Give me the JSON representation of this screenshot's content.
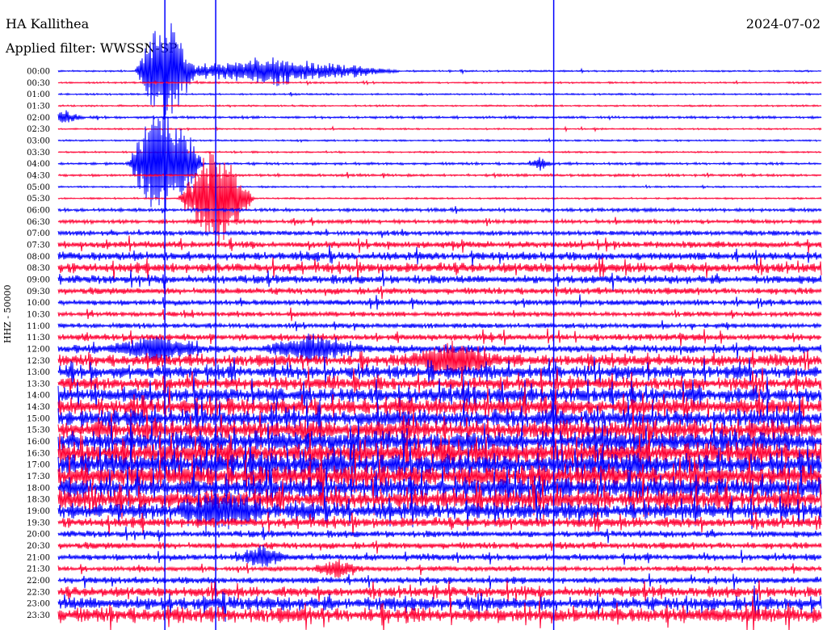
{
  "header": {
    "station": "HA Kallithea",
    "date": "2024-07-02",
    "filter": "Applied filter: WWSSN-SP",
    "ylabel": "HHZ - 50000"
  },
  "colors": {
    "trace_a": "#0000ff",
    "trace_b": "#ff0033"
  },
  "chart_data": {
    "type": "line",
    "title": "HA Kallithea",
    "subtitle": "Applied filter: WWSSN-SP",
    "date": "2024-07-02",
    "ylabel": "HHZ - 50000",
    "rows": [
      "00:00",
      "00:30",
      "01:00",
      "01:30",
      "02:00",
      "02:30",
      "03:00",
      "03:30",
      "04:00",
      "04:30",
      "05:00",
      "05:30",
      "06:00",
      "06:30",
      "07:00",
      "07:30",
      "08:00",
      "08:30",
      "09:00",
      "09:30",
      "10:00",
      "10:30",
      "11:00",
      "11:30",
      "12:00",
      "12:30",
      "13:00",
      "13:30",
      "14:00",
      "14:30",
      "15:00",
      "15:30",
      "16:00",
      "16:30",
      "17:00",
      "17:30",
      "18:00",
      "18:30",
      "19:00",
      "19:30",
      "20:00",
      "20:30",
      "21:00",
      "21:30",
      "22:00",
      "22:30",
      "23:00",
      "23:30"
    ],
    "noise_level": [
      1,
      1,
      1,
      1,
      1.5,
      1,
      1,
      1,
      1.5,
      1.5,
      1,
      1,
      2,
      2.5,
      3,
      4,
      5,
      6,
      5,
      4,
      3.5,
      3,
      3,
      4,
      5,
      7,
      8,
      8,
      9,
      10,
      10,
      11,
      12,
      12,
      13,
      13,
      12,
      11,
      10,
      6,
      4,
      4,
      4,
      3,
      4,
      6,
      8,
      9
    ],
    "events": [
      {
        "row": 0,
        "minute": 8.5,
        "amp": 20,
        "span": 5
      },
      {
        "row": 0,
        "minute": 4.2,
        "amp": 90,
        "span": 1.2
      },
      {
        "row": 4,
        "minute": 0.1,
        "amp": 10,
        "span": 1
      },
      {
        "row": 8,
        "minute": 4.2,
        "amp": 120,
        "span": 1.5
      },
      {
        "row": 8,
        "minute": 18.9,
        "amp": 8,
        "span": 0.5
      },
      {
        "row": 11,
        "minute": 6.2,
        "amp": 90,
        "span": 1.5
      },
      {
        "row": 24,
        "minute": 3.8,
        "amp": 20,
        "span": 2
      },
      {
        "row": 24,
        "minute": 10.0,
        "amp": 20,
        "span": 2
      },
      {
        "row": 25,
        "minute": 15.5,
        "amp": 25,
        "span": 2
      },
      {
        "row": 38,
        "minute": 6.5,
        "amp": 22,
        "span": 2
      },
      {
        "row": 42,
        "minute": 8.0,
        "amp": 15,
        "span": 1
      },
      {
        "row": 43,
        "minute": 11.0,
        "amp": 14,
        "span": 1
      }
    ],
    "markers": [
      {
        "minute": 4.2,
        "color": "#0000ff"
      },
      {
        "minute": 6.2,
        "color": "#0000ff"
      },
      {
        "minute": 19.5,
        "color": "#0000ff"
      }
    ]
  }
}
